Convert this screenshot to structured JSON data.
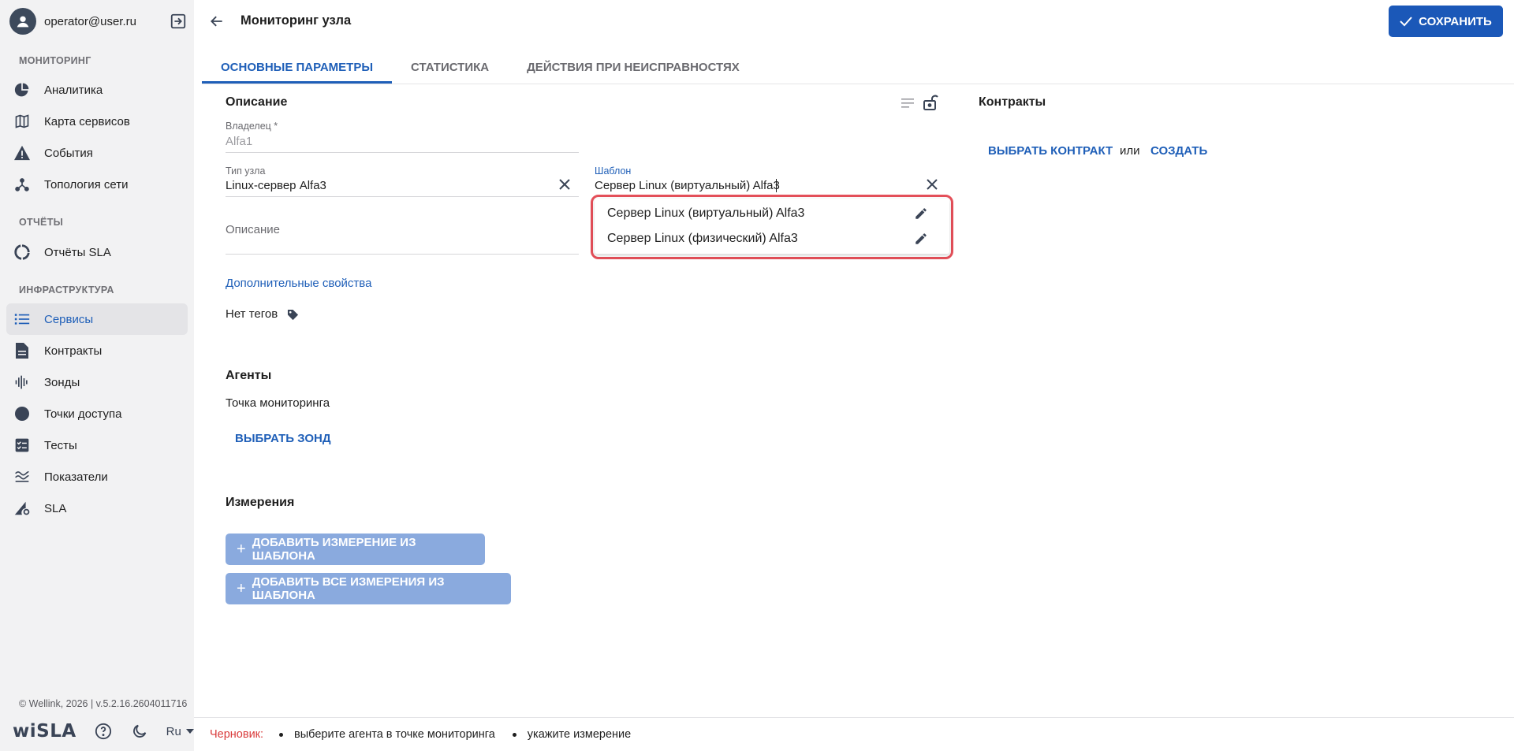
{
  "user": {
    "email": "operator@user.ru"
  },
  "sidebar": {
    "sections": [
      {
        "title": "МОНИТОРИНГ"
      },
      {
        "title": "ОТЧЁТЫ"
      },
      {
        "title": "ИНФРАСТРУКТУРА"
      }
    ],
    "items": [
      {
        "label": "Аналитика",
        "icon": "pie-chart-icon"
      },
      {
        "label": "Карта сервисов",
        "icon": "map-icon"
      },
      {
        "label": "События",
        "icon": "warning-icon"
      },
      {
        "label": "Топология сети",
        "icon": "topology-icon"
      },
      {
        "label": "Отчёты SLA",
        "icon": "donut-icon"
      },
      {
        "label": "Сервисы",
        "icon": "list-icon",
        "active": true
      },
      {
        "label": "Контракты",
        "icon": "document-icon"
      },
      {
        "label": "Зонды",
        "icon": "probe-icon"
      },
      {
        "label": "Точки доступа",
        "icon": "circle-icon"
      },
      {
        "label": "Тесты",
        "icon": "checklist-icon"
      },
      {
        "label": "Показатели",
        "icon": "waves-icon"
      },
      {
        "label": "SLA",
        "icon": "sla-icon"
      }
    ],
    "copyright": "© Wellink, 2026 | v.5.2.16.2604011716",
    "logo": "wiSLA",
    "language": "Ru"
  },
  "header": {
    "title": "Мониторинг узла",
    "save_label": "СОХРАНИТЬ"
  },
  "tabs": [
    {
      "label": "Основные параметры",
      "active": true
    },
    {
      "label": "Статистика"
    },
    {
      "label": "Действия при неисправностях"
    }
  ],
  "description_section": {
    "title": "Описание",
    "owner_label": "Владелец *",
    "owner_value": "Alfa1",
    "node_type_label": "Тип узла",
    "node_type_value": "Linux-сервер Alfa3",
    "template_label": "Шаблон",
    "template_value": "Сервер Linux (виртуальный) Alfa3",
    "description_placeholder": "Описание",
    "extra_props_link": "Дополнительные свойства",
    "no_tags": "Нет тегов"
  },
  "template_dropdown": {
    "options": [
      "Сервер Linux (виртуальный) Alfa3",
      "Сервер Linux (физический) Alfa3"
    ]
  },
  "contracts_section": {
    "title": "Контракты",
    "choose_label": "ВЫБРАТЬ КОНТРАКТ",
    "or": "или",
    "create_label": "СОЗДАТЬ"
  },
  "agents_section": {
    "title": "Агенты",
    "monitoring_point": "Точка мониторинга",
    "choose_probe": "ВЫБРАТЬ ЗОНД"
  },
  "measurements_section": {
    "title": "Измерения",
    "add_one": "ДОБАВИТЬ ИЗМЕРЕНИЕ ИЗ ШАБЛОНА",
    "add_all": "ДОБАВИТЬ ВСЕ ИЗМЕРЕНИЯ ИЗ ШАБЛОНА"
  },
  "footer": {
    "draft": "Черновик:",
    "hints": [
      "выберите агента в точке мониторинга",
      "укажите измерение"
    ]
  },
  "colors": {
    "accent": "#1b58b8",
    "link": "#1f5fb8",
    "highlight": "#e5505a",
    "draft": "#d93b3b",
    "sidebar_bg": "#f2f2f3"
  }
}
